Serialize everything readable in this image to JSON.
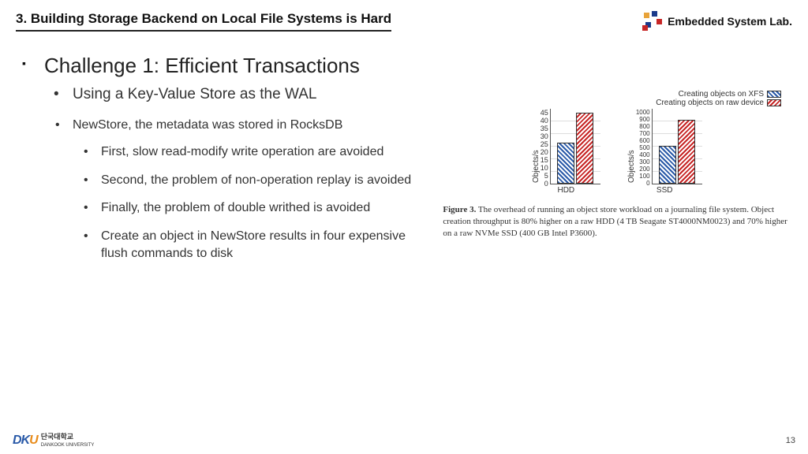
{
  "section_title": "3. Building Storage Backend on Local File Systems is Hard",
  "lab_name": "Embedded System Lab.",
  "heading1": "Challenge 1: Efficient Transactions",
  "heading2": "Using a Key-Value Store as the WAL",
  "bullets": {
    "b1": "NewStore, the metadata was stored in RocksDB",
    "b2": "First, slow read-modify write operation are avoided",
    "b3": "Second, the problem of non-operation replay is avoided",
    "b4": "Finally, the problem of double writhed is avoided",
    "b5": "Create an object in NewStore results in four expensive flush commands to disk"
  },
  "legend": {
    "xfs": "Creating objects on XFS",
    "raw": "Creating objects on raw device"
  },
  "chart_data": [
    {
      "type": "bar",
      "ylabel": "Objects/s",
      "xlabel": "HDD",
      "ylim": [
        0,
        45
      ],
      "yticks": [
        "45",
        "40",
        "35",
        "30",
        "25",
        "20",
        "15",
        "10",
        "5",
        "0"
      ],
      "series": [
        {
          "name": "Creating objects on XFS",
          "value": 26
        },
        {
          "name": "Creating objects on raw device",
          "value": 43
        }
      ]
    },
    {
      "type": "bar",
      "ylabel": "Objects/s",
      "xlabel": "SSD",
      "ylim": [
        0,
        1000
      ],
      "yticks": [
        "1000",
        "900",
        "800",
        "700",
        "600",
        "500",
        "400",
        "300",
        "200",
        "100",
        "0"
      ],
      "series": [
        {
          "name": "Creating objects on XFS",
          "value": 510
        },
        {
          "name": "Creating objects on raw device",
          "value": 850
        }
      ]
    }
  ],
  "caption_label": "Figure 3.",
  "caption_text": " The overhead of running an object store workload on a journaling file system. Object creation throughput is 80% higher on a raw HDD (4 TB Seagate ST4000NM0023) and 70% higher on a raw NVMe SSD (400 GB Intel P3600).",
  "university": {
    "name_ko": "단국대학교",
    "name_en": "DANKOOK UNIVERSITY"
  },
  "page_number": "13"
}
